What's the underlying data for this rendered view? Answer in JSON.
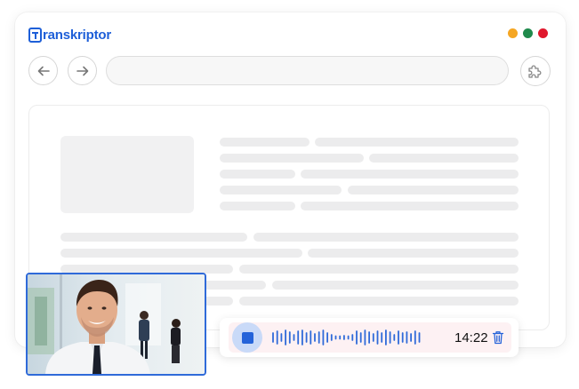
{
  "app": {
    "logo_text": "ranskriptor",
    "logo_initial": "T",
    "brand_color": "#1e5fd8"
  },
  "window_controls": [
    {
      "name": "minimize",
      "color": "#f5a623"
    },
    {
      "name": "maximize",
      "color": "#1f8a4c"
    },
    {
      "name": "close",
      "color": "#e0182d"
    }
  ],
  "toolbar": {
    "back_icon": "arrow-left-icon",
    "forward_icon": "arrow-right-icon",
    "url_value": "",
    "extension_icon": "puzzle-icon"
  },
  "recorder": {
    "timer": "14:22",
    "stop_icon": "stop-icon",
    "delete_icon": "trash-icon",
    "accent_color": "#2563d9",
    "waveform_color": "#2f6ad9"
  },
  "webcam": {
    "border_color": "#2f6ad9"
  }
}
